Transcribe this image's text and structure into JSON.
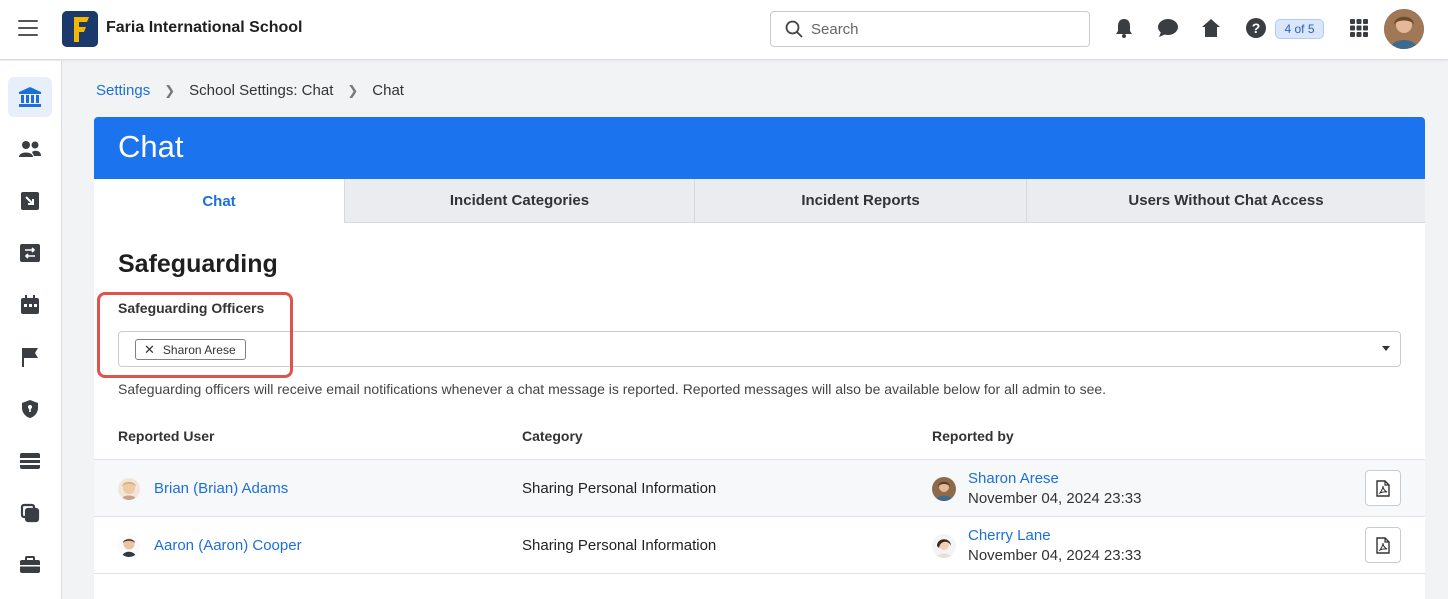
{
  "header": {
    "school_name": "Faria International School",
    "search_placeholder": "Search",
    "page_badge": "4 of 5"
  },
  "breadcrumb": [
    "Settings",
    "School Settings: Chat",
    "Chat"
  ],
  "card": {
    "title": "Chat",
    "tabs": [
      "Chat",
      "Incident Categories",
      "Incident Reports",
      "Users Without Chat Access"
    ],
    "active_tab": "Chat"
  },
  "safeguarding": {
    "title": "Safeguarding",
    "officers_label": "Safeguarding Officers",
    "officers": [
      "Sharon Arese"
    ],
    "help_text": "Safeguarding officers will receive email notifications whenever a chat message is reported. Reported messages will also be available below for all admin to see."
  },
  "table": {
    "headers": [
      "Reported User",
      "Category",
      "Reported by"
    ],
    "rows": [
      {
        "reported_user": "Brian (Brian) Adams",
        "category": "Sharing Personal Information",
        "reported_by": "Sharon Arese",
        "date": "November 04, 2024 23:33"
      },
      {
        "reported_user": "Aaron (Aaron) Cooper",
        "category": "Sharing Personal Information",
        "reported_by": "Cherry Lane",
        "date": "November 04, 2024 23:33"
      }
    ]
  },
  "colors": {
    "brand_blue": "#1b73ee",
    "link_blue": "#1c6fd8",
    "highlight_red": "#e0534a"
  }
}
